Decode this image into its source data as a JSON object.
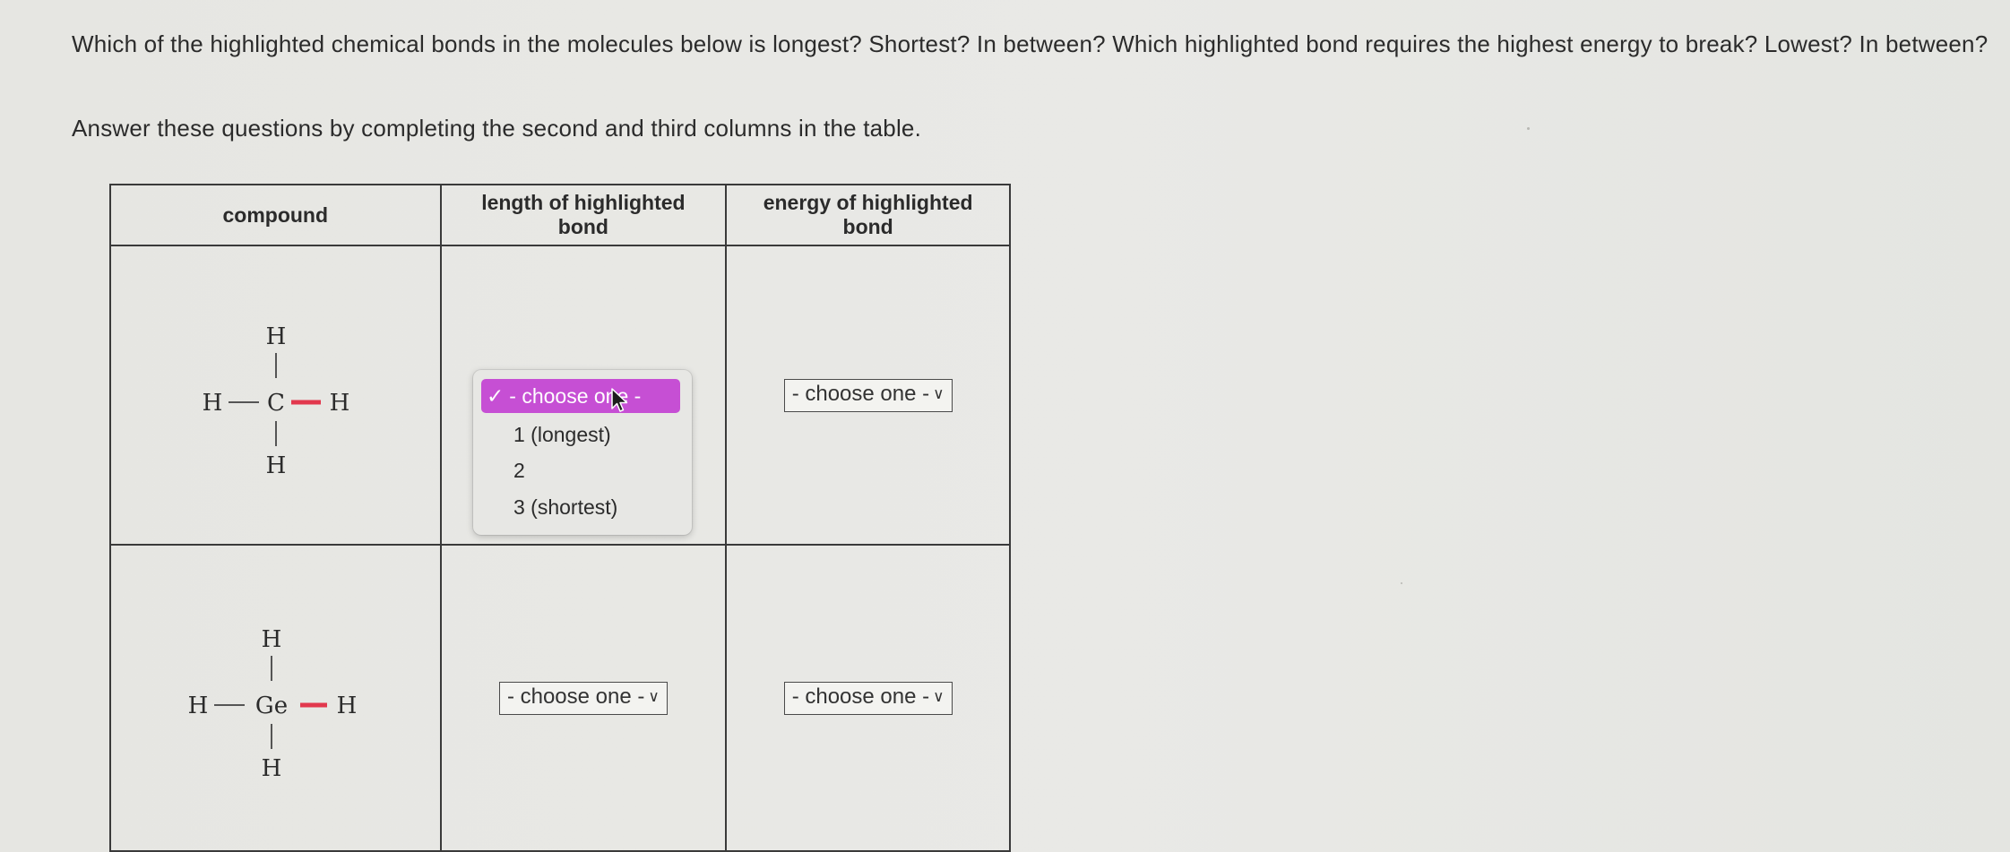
{
  "question": {
    "text": "Which of the highlighted chemical bonds in the molecules below is longest? Shortest? In between? Which highlighted bond requires the highest energy to break? Lowest? In between?",
    "instruction": "Answer these questions by completing the second and third columns in the table."
  },
  "table": {
    "headers": {
      "compound": "compound",
      "length_line1": "length of highlighted",
      "length_line2": "bond",
      "energy_line1": "energy of highlighted",
      "energy_line2": "bond"
    },
    "rows": [
      {
        "atoms": {
          "top": "H",
          "left": "H",
          "center": "C",
          "right": "H",
          "bottom": "H"
        },
        "length_select": {
          "value": "- choose one -",
          "open": true
        },
        "energy_select": {
          "value": "- choose one -",
          "open": false
        }
      },
      {
        "atoms": {
          "top": "H",
          "left": "H",
          "center": "Ge",
          "right": "H",
          "bottom": "H"
        },
        "length_select": {
          "value": "- choose one -",
          "open": false
        },
        "energy_select": {
          "value": "- choose one -",
          "open": false
        }
      }
    ]
  },
  "dropdown": {
    "selected": "- choose one -",
    "options": [
      "1 (longest)",
      "2",
      "3 (shortest)"
    ]
  },
  "colors": {
    "highlight_bond": "#e2384d",
    "dropdown_selected_bg": "#c64fd4"
  },
  "icons": {
    "check": "checkmark-icon",
    "chevron": "chevron-down-icon",
    "cursor": "mouse-pointer-icon"
  }
}
